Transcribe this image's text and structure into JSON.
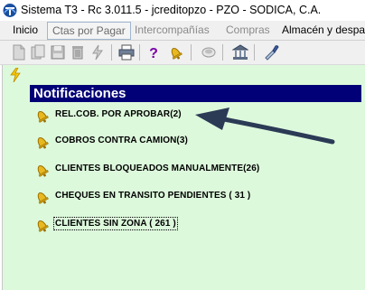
{
  "window": {
    "title": "Sistema T3 - Rc 3.011.5 - jcreditopzo - PZO - SODICA, C.A."
  },
  "tabs": [
    {
      "label": "Inicio",
      "state": "normal"
    },
    {
      "label": "Ctas por Pagar",
      "state": "active"
    },
    {
      "label": "Intercompañías",
      "state": "disabled"
    },
    {
      "label": "Compras",
      "state": "disabled"
    },
    {
      "label": "Almacén y despacho",
      "state": "normal"
    }
  ],
  "toolbar": {
    "icons": [
      "new-document-icon",
      "copy-icon",
      "save-icon",
      "delete-icon",
      "process-icon",
      "print-icon",
      "help-icon",
      "bell-icon",
      "cup-icon",
      "bank-icon",
      "pipette-icon"
    ]
  },
  "notifications": {
    "header": "Notificaciones",
    "items": [
      {
        "label": "REL.COB. POR APROBAR(2)"
      },
      {
        "label": "COBROS CONTRA CAMION(3)"
      },
      {
        "label": "CLIENTES BLOQUEADOS MANUALMENTE(26)"
      },
      {
        "label": "CHEQUES EN TRANSITO PENDIENTES  ( 31 )"
      },
      {
        "label": "CLIENTES SIN ZONA  ( 261 )"
      }
    ]
  },
  "colors": {
    "header_bg": "#020076",
    "panel_bg": "#ddf9dc",
    "arrow": "#2b3a55"
  }
}
